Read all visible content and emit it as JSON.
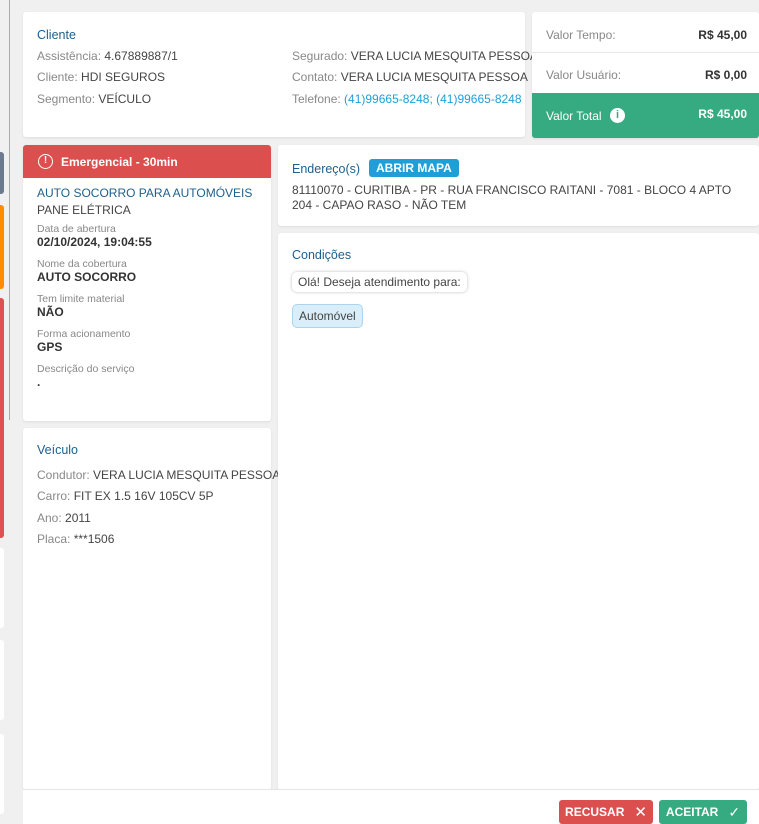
{
  "cliente": {
    "title": "Cliente",
    "assistencia_label": "Assistência:",
    "assistencia": "4.67889887/1",
    "cliente_label": "Cliente:",
    "cliente": "HDI SEGUROS",
    "segmento_label": "Segmento:",
    "segmento": "VEÍCULO",
    "segurado_label": "Segurado:",
    "segurado": "VERA LUCIA MESQUITA PESSOA",
    "contato_label": "Contato:",
    "contato": "VERA LUCIA MESQUITA PESSOA",
    "telefone_label": "Telefone:",
    "telefone": "(41)99665-8248; (41)99665-8248"
  },
  "valores": {
    "tempo_label": "Valor Tempo:",
    "tempo": "R$ 45,00",
    "usuario_label": "Valor Usuário:",
    "usuario": "R$ 0,00",
    "total_label": "Valor Total",
    "total": "R$ 45,00",
    "total_color": "#36aa80"
  },
  "servico": {
    "priority": "Emergencial - 30min",
    "priority_color": "#dc4f4f",
    "name": "AUTO SOCORRO PARA AUTOMÓVEIS",
    "problem": "PANE ELÉTRICA",
    "fields": [
      {
        "label": "Data de abertura",
        "value": "02/10/2024, 19:04:55"
      },
      {
        "label": "Nome da cobertura",
        "value": "AUTO SOCORRO"
      },
      {
        "label": "Tem limite material",
        "value": "NÃO"
      },
      {
        "label": "Forma acionamento",
        "value": "GPS"
      },
      {
        "label": "Descrição do serviço",
        "value": "."
      }
    ]
  },
  "veiculo": {
    "title": "Veículo",
    "condutor_label": "Condutor:",
    "condutor": "VERA LUCIA MESQUITA PESSOA",
    "carro_label": "Carro:",
    "carro": "FIT EX 1.5 16V 105CV 5P",
    "ano_label": "Ano:",
    "ano": "2011",
    "placa_label": "Placa:",
    "placa": "***1506"
  },
  "endereco": {
    "title": "Endereço(s)",
    "map_button": "ABRIR MAPA",
    "address": "81110070 - CURITIBA - PR - RUA FRANCISCO RAITANI - 7081 - BLOCO 4 APTO 204 - CAPAO RASO - NÃO TEM"
  },
  "condicoes": {
    "title": "Condições",
    "question": "Olá! Deseja atendimento para:",
    "answer": "Automóvel"
  },
  "footer": {
    "refuse": "RECUSAR",
    "accept": "ACEITAR"
  }
}
